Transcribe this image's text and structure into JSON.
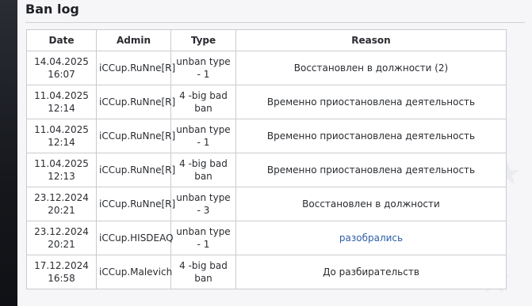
{
  "page": {
    "title": "Ban log"
  },
  "table": {
    "headers": [
      "Date",
      "Admin",
      "Type",
      "Reason"
    ],
    "rows": [
      {
        "date_line1": "14.04.2025",
        "date_line2": "16:07",
        "admin": "iCCup.RuNne[R]",
        "type": "unban type - 1",
        "reason": "Восстановлен в должности (2)"
      },
      {
        "date_line1": "11.04.2025",
        "date_line2": "12:14",
        "admin": "iCCup.RuNne[R]",
        "type": "4 -big bad ban",
        "reason": "Временно приостановлена деятельность"
      },
      {
        "date_line1": "11.04.2025",
        "date_line2": "12:14",
        "admin": "iCCup.RuNne[R]",
        "type": "unban type - 1",
        "reason": "Временно приостановлена деятельность"
      },
      {
        "date_line1": "11.04.2025",
        "date_line2": "12:13",
        "admin": "iCCup.RuNne[R]",
        "type": "4 -big bad ban",
        "reason": "Временно приостановлена деятельность"
      },
      {
        "date_line1": "23.12.2024",
        "date_line2": "20:21",
        "admin": "iCCup.RuNne[R]",
        "type": "unban type - 3",
        "reason": "Восстановлен в должности"
      },
      {
        "date_line1": "23.12.2024",
        "date_line2": "20:21",
        "admin": "iCCup.HISDEAQ",
        "type": "unban type - 1",
        "reason": "разобрались",
        "reason_is_link": true
      },
      {
        "date_line1": "17.12.2024",
        "date_line2": "16:58",
        "admin": "iCCup.Malevich",
        "type": "4 -big bad ban",
        "reason": "До разбирательств"
      }
    ]
  },
  "colors": {
    "link": "#2f5ea8",
    "border": "#c9cbd0",
    "panel_bg": "#f6f6f8"
  }
}
